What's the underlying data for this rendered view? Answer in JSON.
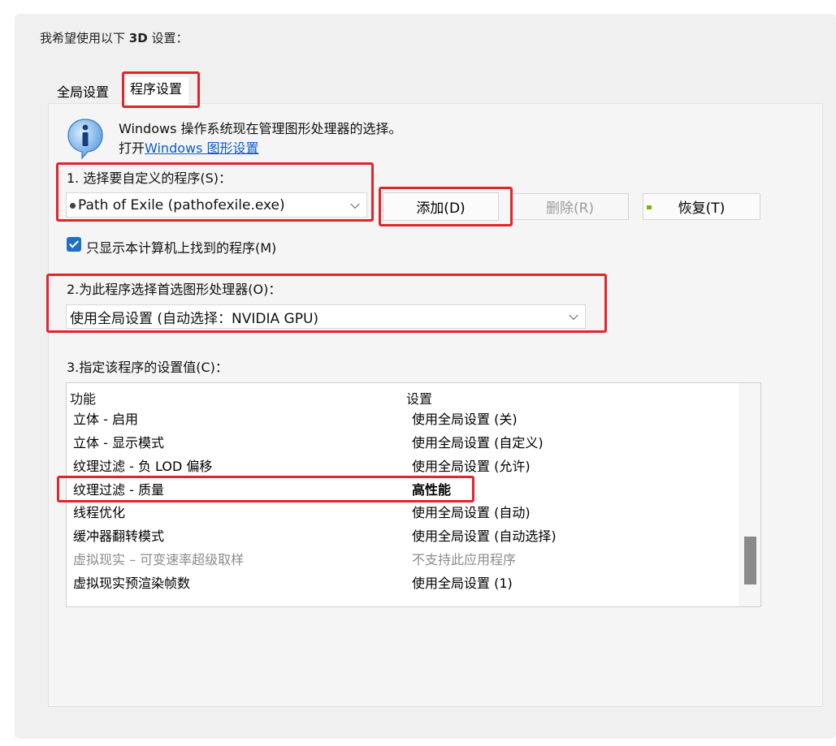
{
  "heading": {
    "prefix": "我希望使用以下 ",
    "bold": "3D",
    "suffix": " 设置："
  },
  "tabs": [
    {
      "label": "全局设置"
    },
    {
      "label": "程序设置"
    }
  ],
  "info": {
    "line1": "Windows 操作系统现在管理图形处理器的选择。",
    "line2_prefix": "打开",
    "link": "Windows 图形设置"
  },
  "program_select": {
    "label": "1. 选择要自定义的程序(S)：",
    "value": "Path of Exile (pathofexile.exe)",
    "add_label": "添加(D)",
    "remove_label": "删除(R)",
    "restore_label": "恢复(T)"
  },
  "only_show": {
    "label": "只显示本计算机上找到的程序(M)",
    "checked": true
  },
  "gpu_select": {
    "label": "2.为此程序选择首选图形处理器(O)：",
    "value": "使用全局设置 (自动选择：NVIDIA GPU)"
  },
  "settings": {
    "label": "3.指定该程序的设置值(C)：",
    "col_feature": "功能",
    "col_setting": "设置",
    "rows": [
      {
        "feature": "立体 - 启用",
        "setting": "使用全局设置 (关)"
      },
      {
        "feature": "立体 - 显示模式",
        "setting": "使用全局设置 (自定义)"
      },
      {
        "feature": "纹理过滤 - 负 LOD 偏移",
        "setting": "使用全局设置 (允许)"
      },
      {
        "feature": "纹理过滤 - 质量",
        "setting": "高性能"
      },
      {
        "feature": "线程优化",
        "setting": "使用全局设置 (自动)"
      },
      {
        "feature": "缓冲器翻转模式",
        "setting": "使用全局设置 (自动选择)"
      },
      {
        "feature": "虚拟现实 – 可变速率超级取样",
        "setting": "不支持此应用程序"
      },
      {
        "feature": "虚拟现实预渲染帧数",
        "setting": "使用全局设置 (1)"
      }
    ]
  },
  "colors": {
    "highlight": "#e3242b",
    "link": "#0a5ec7",
    "checkbox": "#1f6fc5",
    "nvidia": "#76b900"
  },
  "icons": [
    "info-icon",
    "program-icon",
    "nvidia-icon",
    "checkmark-icon",
    "chevron-down-icon"
  ]
}
